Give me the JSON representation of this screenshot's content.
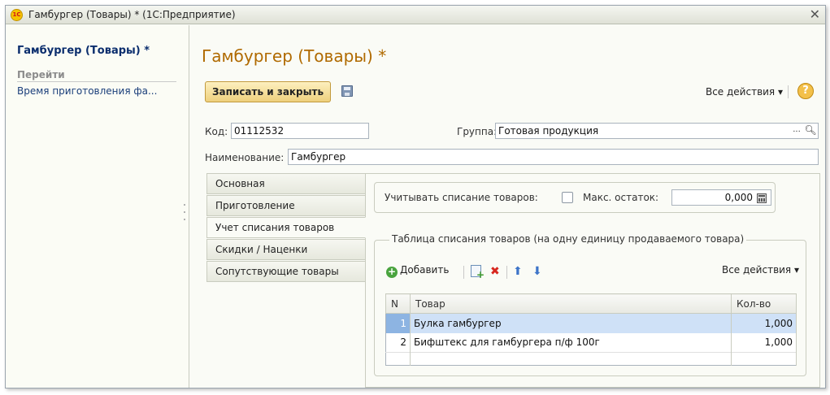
{
  "window": {
    "title": "Гамбургер (Товары) * (1С:Предприятие)",
    "logo_text": "1С"
  },
  "left": {
    "title": "Гамбургер (Товары) *",
    "section": "Перейти",
    "link": "Время приготовления фа..."
  },
  "form": {
    "title": "Гамбургер (Товары) *",
    "save_close": "Записать и закрыть",
    "all_actions": "Все действия ▾",
    "help": "?",
    "code_label": "Код:",
    "code_value": "01112532",
    "group_label": "Группа:",
    "group_value": "Готовая продукция",
    "name_label": "Наименование:",
    "name_value": "Гамбургер"
  },
  "tabs": [
    {
      "label": "Основная"
    },
    {
      "label": "Приготовление"
    },
    {
      "label": "Учет списания товаров"
    },
    {
      "label": "Скидки / Наценки"
    },
    {
      "label": "Сопутствующие товары"
    }
  ],
  "panel": {
    "writeoff_label": "Учитывать списание товаров:",
    "max_label": "Макс. остаток:",
    "max_value": "0,000",
    "group_title": "Таблица списания товаров (на одну единицу продаваемого товара)",
    "add_label": "Добавить",
    "all_actions": "Все действия ▾",
    "columns": {
      "n": "N",
      "item": "Товар",
      "qty": "Кол-во"
    },
    "rows": [
      {
        "n": "1",
        "item": "Булка гамбургер",
        "qty": "1,000"
      },
      {
        "n": "2",
        "item": "Бифштекс для гамбургера п/ф 100г",
        "qty": "1,000"
      }
    ]
  }
}
